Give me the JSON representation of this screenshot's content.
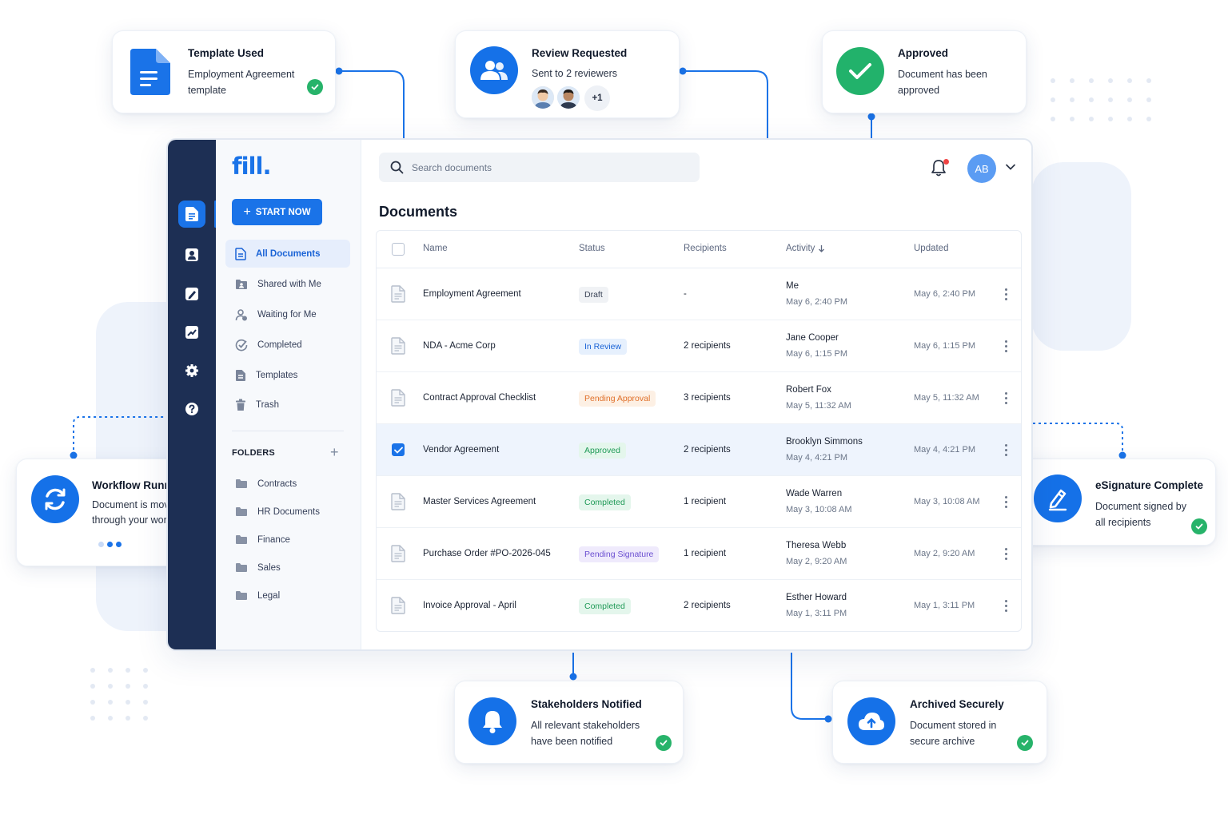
{
  "brand": {
    "logo": "fill.",
    "accent": "#1a73e8",
    "rail": "#1d2f54",
    "success": "#27b36a"
  },
  "cards": {
    "template_used": {
      "title": "Template Used",
      "desc1": "Employment Agreement",
      "desc2": "template",
      "icon": "document-icon"
    },
    "review_requested": {
      "title": "Review Requested",
      "desc": "Sent to 2 reviewers",
      "more": "+1",
      "icon": "users-icon"
    },
    "approved": {
      "title": "Approved",
      "desc1": "Document has been",
      "desc2": "approved",
      "icon": "checkmark-icon"
    },
    "workflow_running": {
      "title": "Workflow Running",
      "desc1": "Document is moving",
      "desc2": "through your workflow",
      "icon": "sync-icon"
    },
    "esignature_complete": {
      "title": "eSignature Complete",
      "desc1": "Document signed by",
      "desc2": "all recipients",
      "icon": "pen-icon"
    },
    "stakeholders_notified": {
      "title": "Stakeholders Notified",
      "desc1": "All relevant stakeholders",
      "desc2": "have been notified",
      "icon": "bell-icon"
    },
    "archived_securely": {
      "title": "Archived Securely",
      "desc1": "Document stored in",
      "desc2": "secure archive",
      "icon": "cloud-upload-icon"
    }
  },
  "sidebar": {
    "start_label": "START NOW",
    "nav": [
      {
        "label": "All Documents",
        "icon": "document-icon",
        "active": true
      },
      {
        "label": "Shared with Me",
        "icon": "shared-folder-icon"
      },
      {
        "label": "Waiting for Me",
        "icon": "person-clock-icon"
      },
      {
        "label": "Completed",
        "icon": "check-pen-icon"
      },
      {
        "label": "Templates",
        "icon": "template-icon"
      },
      {
        "label": "Trash",
        "icon": "trash-icon"
      }
    ],
    "folders_header": "FOLDERS",
    "folders": [
      "Contracts",
      "HR Documents",
      "Finance",
      "Sales",
      "Legal"
    ]
  },
  "header": {
    "search_placeholder": "Search documents",
    "avatar_initials": "AB"
  },
  "main": {
    "title": "Documents"
  },
  "table": {
    "columns": {
      "name": "Name",
      "status": "Status",
      "recipients": "Recipients",
      "activity": "Activity",
      "updated": "Updated"
    },
    "rows": [
      {
        "name": "Employment Agreement",
        "status": "Draft",
        "recipients": "-",
        "activity_by": "Me",
        "activity_time": "May 6, 2:40 PM",
        "updated": "May 6, 2:40 PM"
      },
      {
        "name": "NDA - Acme Corp",
        "status": "In Review",
        "recipients": "2 recipients",
        "activity_by": "Jane Cooper",
        "activity_time": "May 6, 1:15 PM",
        "updated": "May 6, 1:15 PM"
      },
      {
        "name": "Contract Approval Checklist",
        "status": "Pending Approval",
        "recipients": "3 recipients",
        "activity_by": "Robert Fox",
        "activity_time": "May 5, 11:32 AM",
        "updated": "May 5, 11:32 AM"
      },
      {
        "name": "Vendor Agreement",
        "status": "Approved",
        "recipients": "2 recipients",
        "activity_by": "Brooklyn Simmons",
        "activity_time": "May 4, 4:21 PM",
        "updated": "May 4, 4:21 PM",
        "selected": true
      },
      {
        "name": "Master Services Agreement",
        "status": "Completed",
        "recipients": "1 recipient",
        "activity_by": "Wade Warren",
        "activity_time": "May 3, 10:08 AM",
        "updated": "May 3, 10:08 AM"
      },
      {
        "name": "Purchase Order #PO-2026-045",
        "status": "Pending Signature",
        "recipients": "1 recipient",
        "activity_by": "Theresa Webb",
        "activity_time": "May 2, 9:20 AM",
        "updated": "May 2, 9:20 AM"
      },
      {
        "name": "Invoice Approval - April",
        "status": "Completed",
        "recipients": "2 recipients",
        "activity_by": "Esther Howard",
        "activity_time": "May 1, 3:11 PM",
        "updated": "May 1, 3:11 PM"
      }
    ]
  },
  "status_colors": {
    "Draft": {
      "bg": "#f0f2f5",
      "fg": "#3b4457"
    },
    "In Review": {
      "bg": "#e6f0fd",
      "fg": "#1a63d6"
    },
    "Pending Approval": {
      "bg": "#fdf0e4",
      "fg": "#e0702a"
    },
    "Approved": {
      "bg": "#e4f6ec",
      "fg": "#1f9a57"
    },
    "Completed": {
      "bg": "#e4f6ec",
      "fg": "#1f9a57"
    },
    "Pending Signature": {
      "bg": "#efeafc",
      "fg": "#6b4fd1"
    }
  }
}
